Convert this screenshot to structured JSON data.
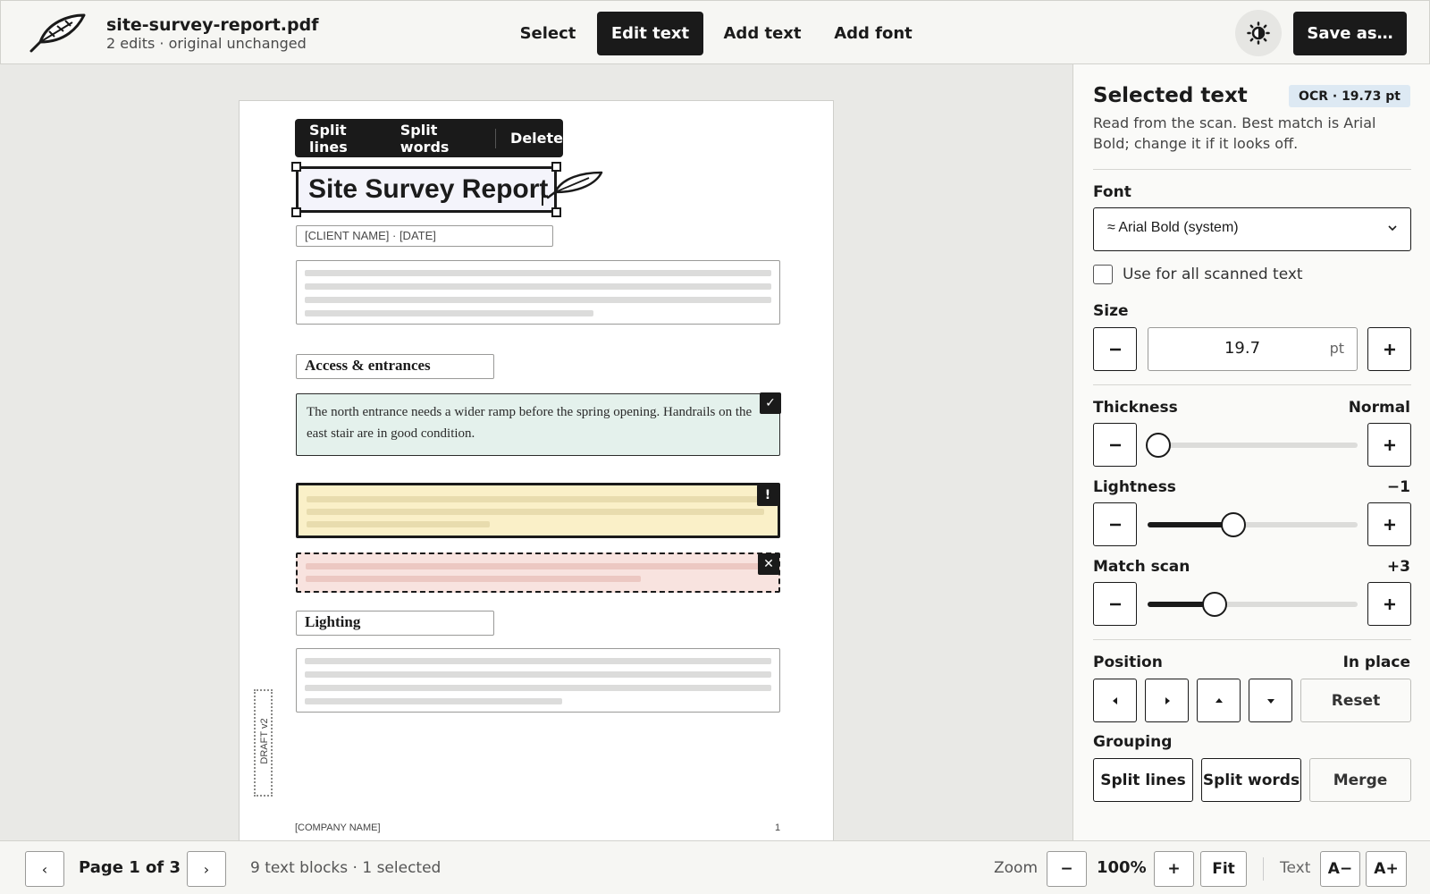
{
  "header": {
    "file_name": "site-survey-report.pdf",
    "file_status": "2 edits · original unchanged",
    "modes": [
      {
        "label": "Select",
        "active": false
      },
      {
        "label": "Edit text",
        "active": true
      },
      {
        "label": "Add text",
        "active": false
      },
      {
        "label": "Add font",
        "active": false
      }
    ],
    "theme_icon": "sun-icon",
    "save_label": "Save as…"
  },
  "document": {
    "context_toolbar": {
      "split_lines": "Split lines",
      "split_words": "Split words",
      "delete": "Delete"
    },
    "title": "Site Survey Report",
    "client_line": "[CLIENT NAME] · [DATE]",
    "section_access": "Access & entrances",
    "note_text": "The north entrance needs a wider ramp before the spring opening. Handrails on the east stair are in good condition.",
    "marker_ok": "✓",
    "marker_warn": "!",
    "marker_error": "✕",
    "section_lighting": "Lighting",
    "draft_tag": "DRAFT v2",
    "footer_company": "[COMPANY NAME]",
    "footer_page": "1"
  },
  "panel": {
    "title": "Selected text",
    "ocr_badge": "OCR · 19.73 pt",
    "description": "Read from the scan. Best match is Arial Bold; change it if it looks off.",
    "font_label": "Font",
    "font_value": "≈ Arial Bold (system)",
    "use_all_label": "Use for all scanned text",
    "use_all_checked": false,
    "size_label": "Size",
    "size_value": "19.7",
    "size_unit": "pt",
    "thickness_label": "Thickness",
    "thickness_value": "Normal",
    "thickness_level": 0.05,
    "lightness_label": "Lightness",
    "lightness_value": "−1",
    "lightness_level": 0.41,
    "match_label": "Match scan",
    "match_value": "+3",
    "match_level": 0.32,
    "position_label": "Position",
    "position_value": "In place",
    "reset_label": "Reset",
    "grouping_label": "Grouping",
    "split_lines": "Split lines",
    "split_words": "Split words",
    "merge": "Merge"
  },
  "footer": {
    "prev_icon": "‹",
    "next_icon": "›",
    "page_label": "Page 1 of 3",
    "blocks_status": "9 text blocks · 1 selected",
    "zoom_label": "Zoom",
    "zoom_minus": "−",
    "zoom_value": "100%",
    "zoom_plus": "+",
    "fit_label": "Fit",
    "text_label": "Text",
    "text_smaller": "A−",
    "text_larger": "A+"
  },
  "colors": {
    "accent": "#1a1a1a",
    "ok_fill": "#e4f1ec",
    "warn_fill": "#faf0c8",
    "error_fill": "#f8e3df",
    "badge_fill": "#dde9f3"
  }
}
